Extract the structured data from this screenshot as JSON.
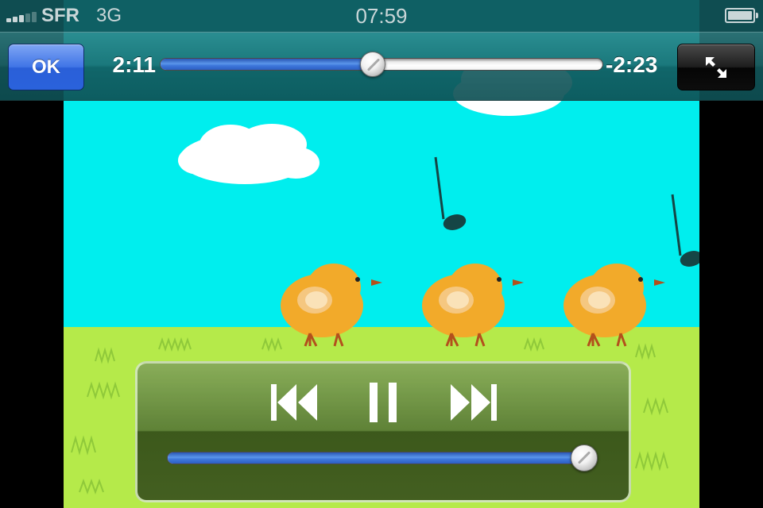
{
  "status_bar": {
    "carrier": "SFR",
    "network": "3G",
    "time": "07:59",
    "signal_icon": "signal-bars-icon",
    "battery_icon": "battery-icon",
    "signal_bars": 3,
    "battery_level": 1.0
  },
  "toolbar": {
    "done_label": "OK",
    "elapsed": "2:11",
    "remaining": "-2:23",
    "progress": 0.48,
    "fullscreen_icon": "fullscreen-toggle-icon"
  },
  "controls": {
    "previous_icon": "skip-previous-icon",
    "pause_icon": "pause-icon",
    "next_icon": "skip-next-icon",
    "volume_level": 0.99
  },
  "colors": {
    "accent": "#3f74e6",
    "sky": "#00eeee",
    "grass": "#b5ea4a"
  }
}
